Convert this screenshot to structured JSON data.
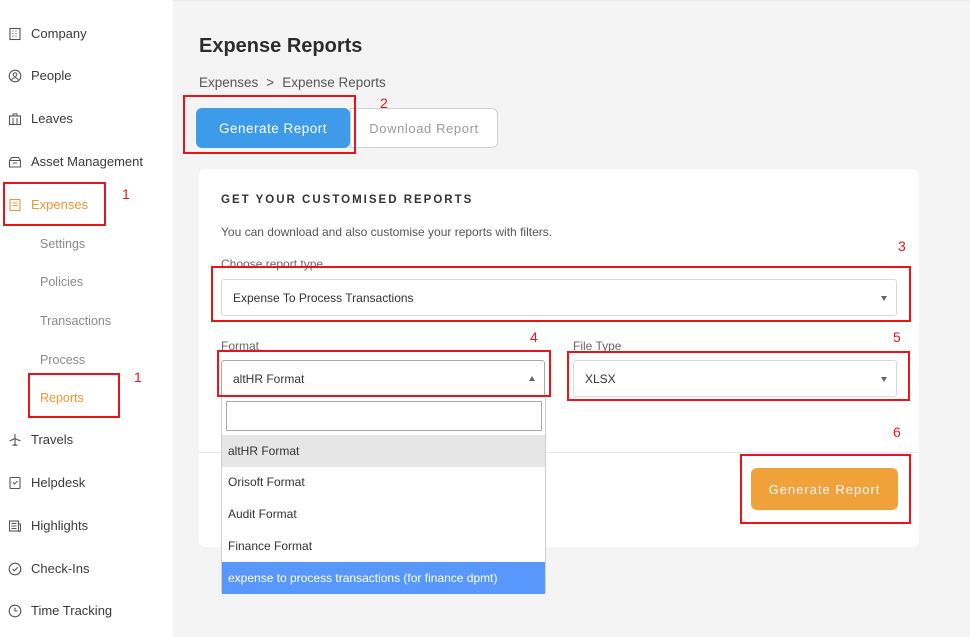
{
  "sidebar": {
    "items": [
      {
        "label": "Company",
        "icon": "building-icon"
      },
      {
        "label": "People",
        "icon": "person-icon"
      },
      {
        "label": "Leaves",
        "icon": "leaves-icon"
      },
      {
        "label": "Asset Management",
        "icon": "box-icon"
      },
      {
        "label": "Expenses",
        "icon": "receipt-icon"
      },
      {
        "label": "Travels",
        "icon": "plane-icon"
      },
      {
        "label": "Helpdesk",
        "icon": "ticket-icon"
      },
      {
        "label": "Highlights",
        "icon": "news-icon"
      },
      {
        "label": "Check-Ins",
        "icon": "check-circle-icon"
      },
      {
        "label": "Time Tracking",
        "icon": "clock-icon"
      }
    ],
    "expenses_sub": [
      "Settings",
      "Policies",
      "Transactions",
      "Process",
      "Reports"
    ]
  },
  "header": {
    "title": "Expense Reports",
    "breadcrumb": [
      "Expenses",
      ">",
      "Expense Reports"
    ]
  },
  "actions": {
    "generate": "Generate Report",
    "download": "Download Report"
  },
  "card": {
    "title": "GET YOUR CUSTOMISED REPORTS",
    "description": "You can download and also customise your reports with filters.",
    "report_type_label": "Choose report type",
    "report_type_value": "Expense To Process Transactions",
    "format_label": "Format",
    "format_value": "altHR Format",
    "file_type_label": "File Type",
    "file_type_value": "XLSX",
    "submit": "Generate Report"
  },
  "format_dropdown": {
    "search_value": "",
    "options": [
      "altHR Format",
      "Orisoft Format",
      "Audit Format",
      "Finance Format",
      "expense to process transactions (for finance dpmt)"
    ]
  },
  "annotations": [
    "1",
    "1",
    "2",
    "3",
    "4",
    "5",
    "6"
  ],
  "colors": {
    "accent": "#f0962e",
    "primary_button": "#3d9be9",
    "orange_button": "#f0a13a",
    "annotation": "#e8141b",
    "dropdown_selected": "#5897fb"
  }
}
